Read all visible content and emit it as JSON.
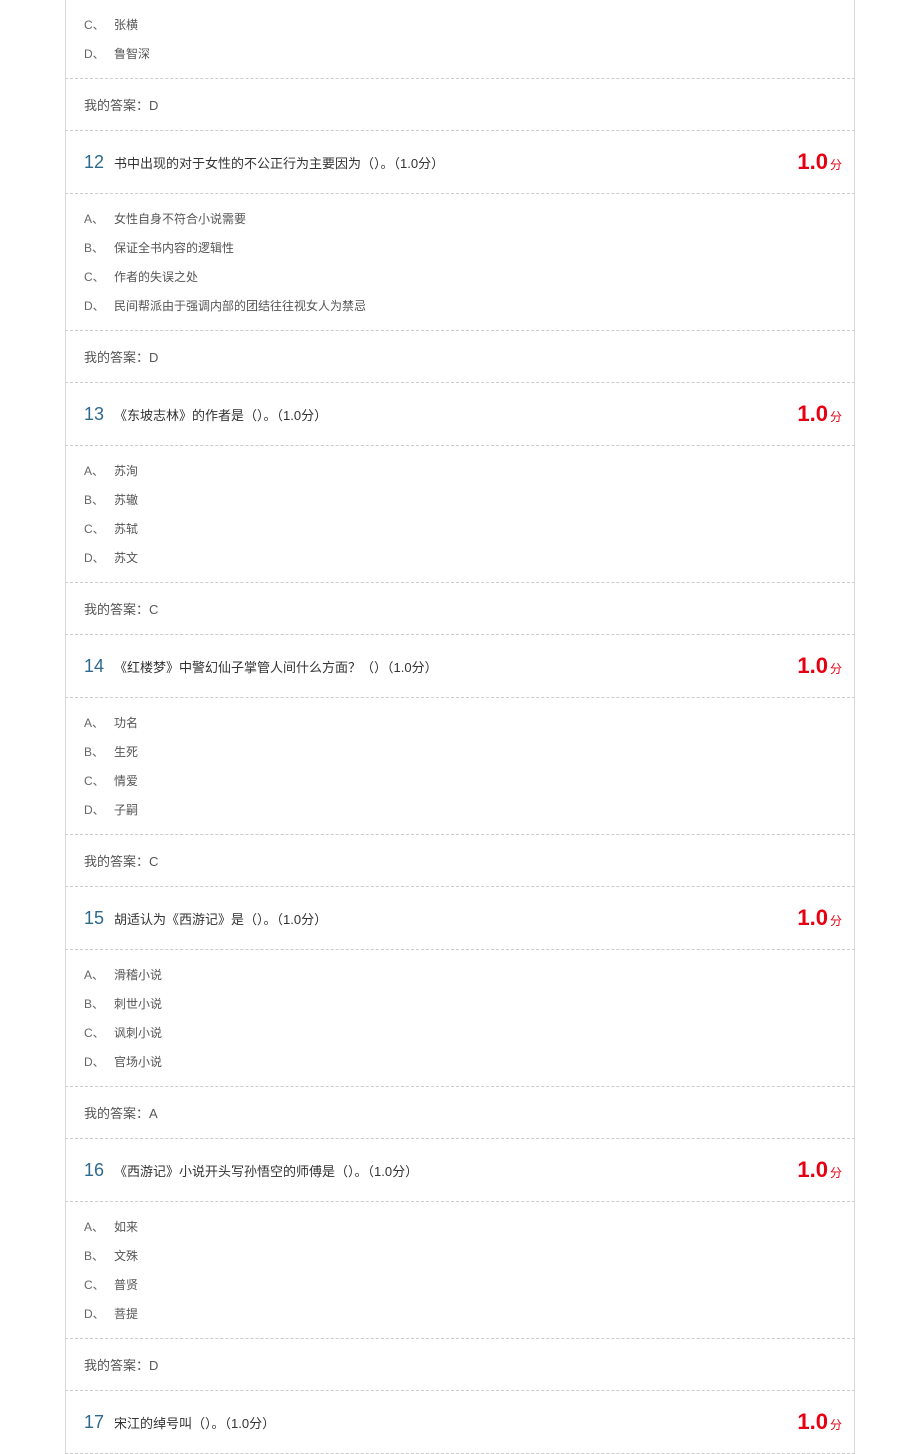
{
  "labels": {
    "my_answer_prefix": "我的答案：",
    "score_unit": "分"
  },
  "questions": [
    {
      "number": "",
      "text": "",
      "score": "",
      "options": [
        {
          "letter": "C、",
          "text": "张横"
        },
        {
          "letter": "D、",
          "text": "鲁智深"
        }
      ],
      "answer": "D",
      "has_header": false
    },
    {
      "number": "12",
      "text": "书中出现的对于女性的不公正行为主要因为（）。（1.0分）",
      "score": "1.0",
      "options": [
        {
          "letter": "A、",
          "text": "女性自身不符合小说需要"
        },
        {
          "letter": "B、",
          "text": "保证全书内容的逻辑性"
        },
        {
          "letter": "C、",
          "text": "作者的失误之处"
        },
        {
          "letter": "D、",
          "text": "民间帮派由于强调内部的团结往往视女人为禁忌"
        }
      ],
      "answer": "D",
      "has_header": true
    },
    {
      "number": "13",
      "text": "《东坡志林》的作者是（）。（1.0分）",
      "score": "1.0",
      "options": [
        {
          "letter": "A、",
          "text": "苏洵"
        },
        {
          "letter": "B、",
          "text": "苏辙"
        },
        {
          "letter": "C、",
          "text": "苏轼"
        },
        {
          "letter": "D、",
          "text": "苏文"
        }
      ],
      "answer": "C",
      "has_header": true
    },
    {
      "number": "14",
      "text": "《红楼梦》中警幻仙子掌管人间什么方面？（）（1.0分）",
      "score": "1.0",
      "options": [
        {
          "letter": "A、",
          "text": "功名"
        },
        {
          "letter": "B、",
          "text": "生死"
        },
        {
          "letter": "C、",
          "text": "情爱"
        },
        {
          "letter": "D、",
          "text": "子嗣"
        }
      ],
      "answer": "C",
      "has_header": true
    },
    {
      "number": "15",
      "text": "胡适认为《西游记》是（）。（1.0分）",
      "score": "1.0",
      "options": [
        {
          "letter": "A、",
          "text": "滑稽小说"
        },
        {
          "letter": "B、",
          "text": "刺世小说"
        },
        {
          "letter": "C、",
          "text": "讽刺小说"
        },
        {
          "letter": "D、",
          "text": "官场小说"
        }
      ],
      "answer": "A",
      "has_header": true
    },
    {
      "number": "16",
      "text": "《西游记》小说开头写孙悟空的师傅是（）。（1.0分）",
      "score": "1.0",
      "options": [
        {
          "letter": "A、",
          "text": "如来"
        },
        {
          "letter": "B、",
          "text": "文殊"
        },
        {
          "letter": "C、",
          "text": "普贤"
        },
        {
          "letter": "D、",
          "text": "菩提"
        }
      ],
      "answer": "D",
      "has_header": true
    },
    {
      "number": "17",
      "text": "宋江的绰号叫（）。（1.0分）",
      "score": "1.0",
      "options": [],
      "answer": "",
      "has_header": true
    }
  ]
}
